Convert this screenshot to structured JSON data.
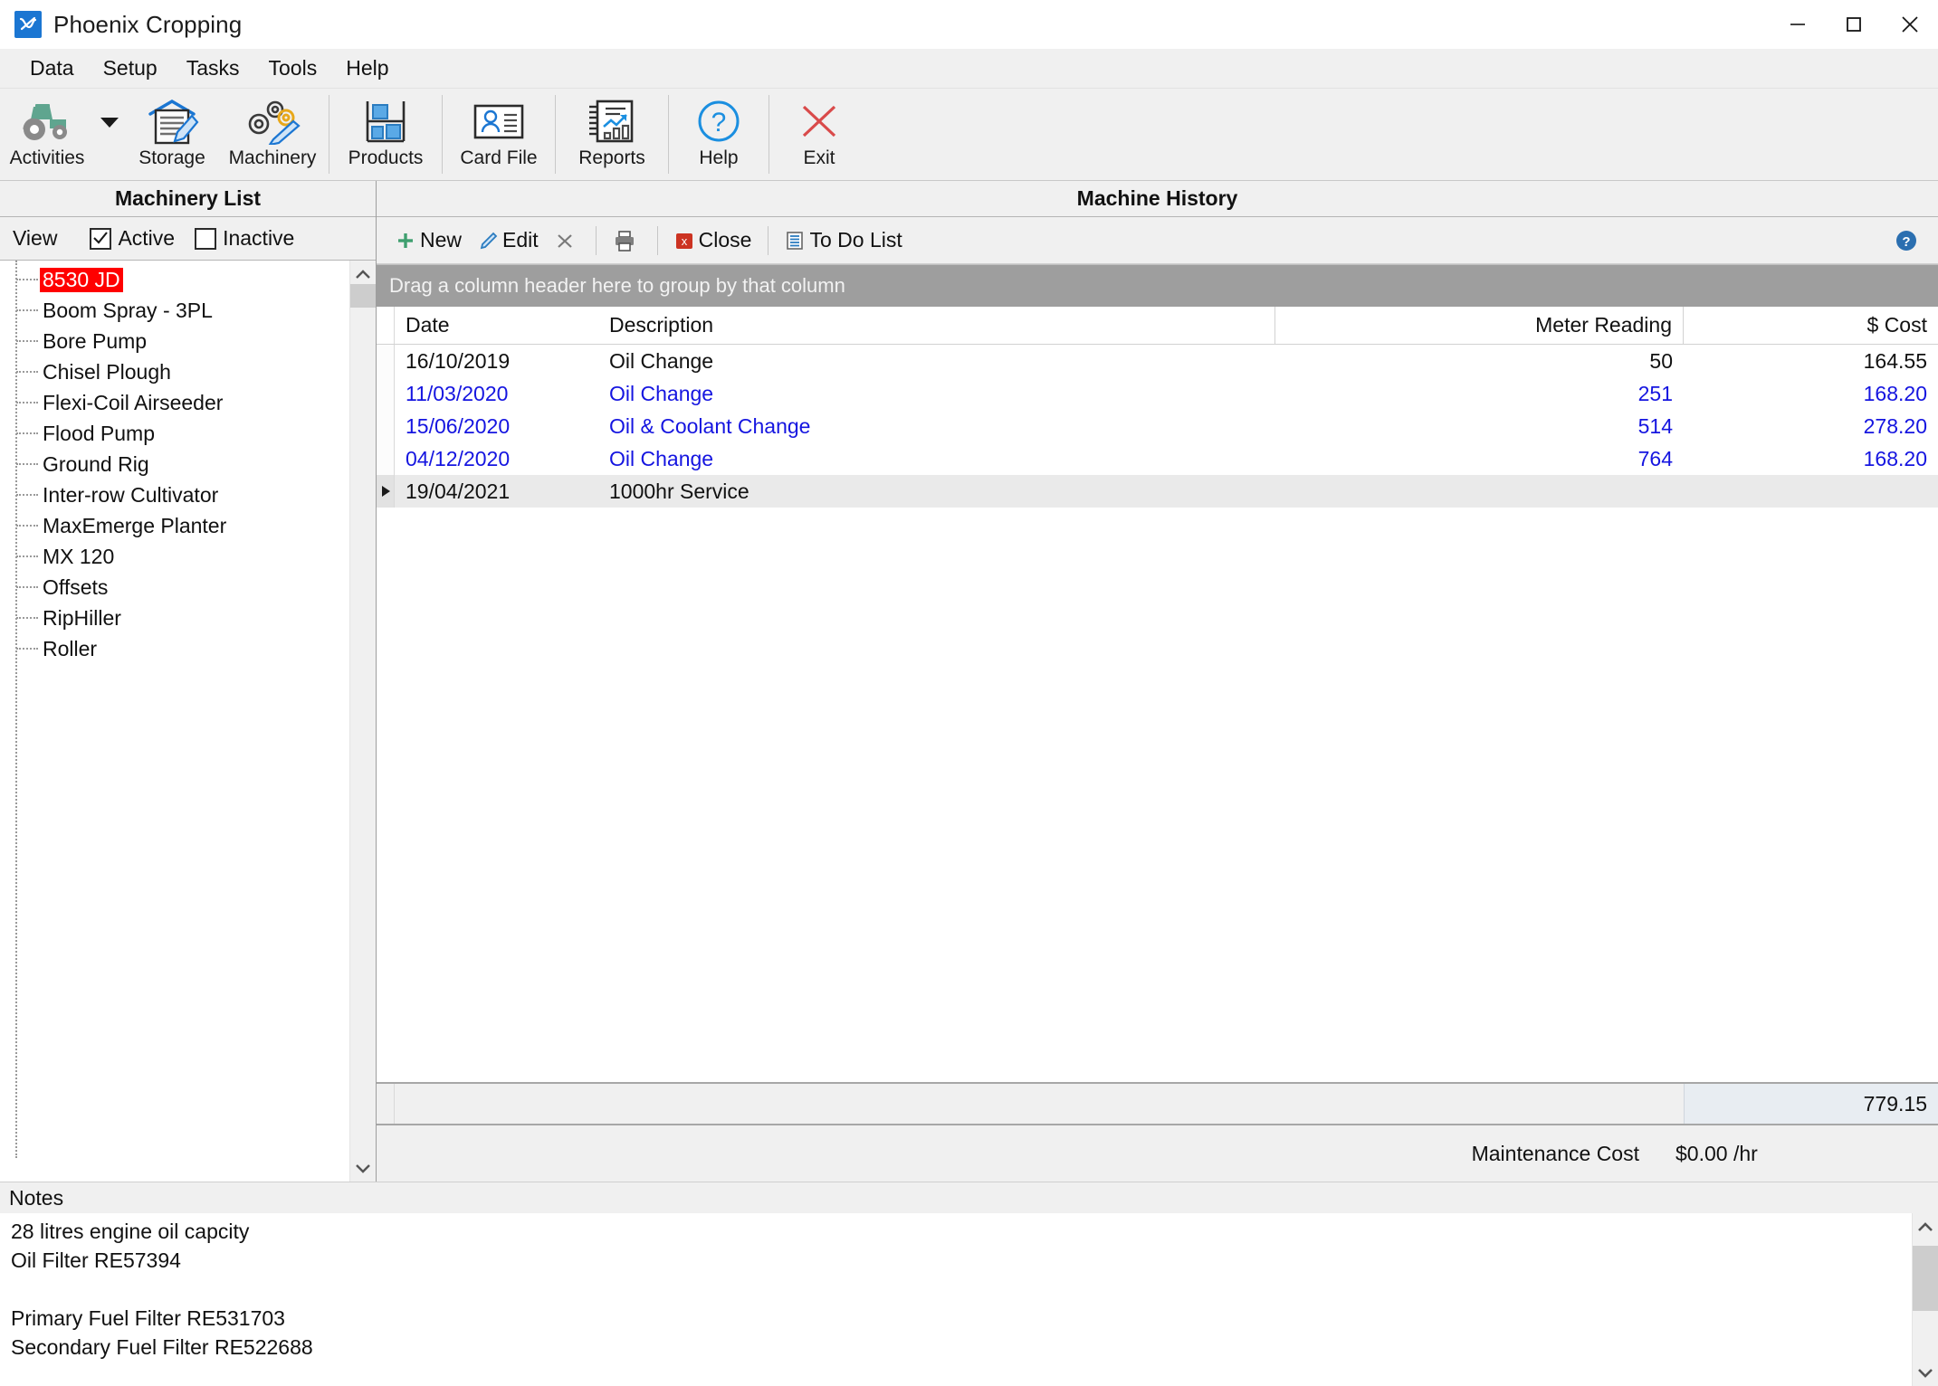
{
  "window": {
    "title": "Phoenix Cropping",
    "logo_glyph": "✕",
    "controls": {
      "minimize": "minimize-icon",
      "maximize": "maximize-icon",
      "close": "close-icon"
    }
  },
  "menubar": {
    "items": [
      {
        "label": "Data"
      },
      {
        "label": "Setup"
      },
      {
        "label": "Tasks"
      },
      {
        "label": "Tools"
      },
      {
        "label": "Help"
      }
    ]
  },
  "ribbon": {
    "buttons": [
      {
        "label": "Activities",
        "icon": "tractor-icon",
        "has_caret": true
      },
      {
        "label": "Storage",
        "icon": "storage-shed-icon",
        "has_caret": false
      },
      {
        "label": "Machinery",
        "icon": "gears-pencil-icon",
        "has_caret": false
      },
      {
        "label": "Products",
        "icon": "shelf-boxes-icon",
        "has_caret": false
      },
      {
        "label": "Card File",
        "icon": "contact-card-icon",
        "has_caret": false
      },
      {
        "label": "Reports",
        "icon": "report-chart-icon",
        "has_caret": false
      },
      {
        "label": "Help",
        "icon": "question-circle-icon",
        "has_caret": false
      },
      {
        "label": "Exit",
        "icon": "red-x-icon",
        "has_caret": false
      }
    ]
  },
  "sidebar": {
    "title": "Machinery List",
    "view_label": "View",
    "filters": [
      {
        "label": "Active",
        "checked": true
      },
      {
        "label": "Inactive",
        "checked": false
      }
    ],
    "selected_item": "8530 JD",
    "items": [
      {
        "label": "8530 JD",
        "selected": true
      },
      {
        "label": "Boom Spray - 3PL",
        "selected": false
      },
      {
        "label": "Bore Pump",
        "selected": false
      },
      {
        "label": "Chisel Plough",
        "selected": false
      },
      {
        "label": "Flexi-Coil Airseeder",
        "selected": false
      },
      {
        "label": "Flood Pump",
        "selected": false
      },
      {
        "label": "Ground Rig",
        "selected": false
      },
      {
        "label": "Inter-row Cultivator",
        "selected": false
      },
      {
        "label": "MaxEmerge Planter",
        "selected": false
      },
      {
        "label": "MX 120",
        "selected": false
      },
      {
        "label": "Offsets",
        "selected": false
      },
      {
        "label": "RipHiller",
        "selected": false
      },
      {
        "label": "Roller",
        "selected": false
      }
    ]
  },
  "main": {
    "title": "Machine History",
    "toolbar": {
      "new_label": "New",
      "edit_label": "Edit",
      "delete_label": "",
      "print_label": "",
      "close_label": "Close",
      "todo_label": "To Do List",
      "help_label": "?"
    },
    "group_panel_text": "Drag a column header here to group by that column",
    "columns": [
      {
        "key": "date",
        "label": "Date",
        "align": "left"
      },
      {
        "key": "description",
        "label": "Description",
        "align": "left"
      },
      {
        "key": "meter",
        "label": "Meter Reading",
        "align": "right"
      },
      {
        "key": "cost",
        "label": "$ Cost",
        "align": "right"
      }
    ],
    "rows": [
      {
        "date": "16/10/2019",
        "description": "Oil Change",
        "meter": "50",
        "cost": "164.55",
        "blue": false,
        "selected": false
      },
      {
        "date": "11/03/2020",
        "description": "Oil Change",
        "meter": "251",
        "cost": "168.20",
        "blue": true,
        "selected": false
      },
      {
        "date": "15/06/2020",
        "description": "Oil & Coolant Change",
        "meter": "514",
        "cost": "278.20",
        "blue": true,
        "selected": false
      },
      {
        "date": "04/12/2020",
        "description": "Oil Change",
        "meter": "764",
        "cost": "168.20",
        "blue": true,
        "selected": false
      },
      {
        "date": "19/04/2021",
        "description": "1000hr Service",
        "meter": "",
        "cost": "",
        "blue": false,
        "selected": true
      }
    ],
    "total_cost": "779.15",
    "maintenance_label": "Maintenance Cost",
    "maintenance_value": "$0.00 /hr"
  },
  "notes": {
    "title": "Notes",
    "lines": [
      "28 litres engine oil capcity",
      "Oil Filter RE57394",
      "",
      "Primary Fuel Filter RE531703",
      "Secondary Fuel Filter RE522688"
    ]
  },
  "colors": {
    "accent_blue": "#1b76d2",
    "selection_red": "#ff0000",
    "link_blue": "#1515e0",
    "tractor_green": "#5fa58f",
    "exit_red": "#d94a4a",
    "group_panel_gray": "#9e9e9e"
  }
}
